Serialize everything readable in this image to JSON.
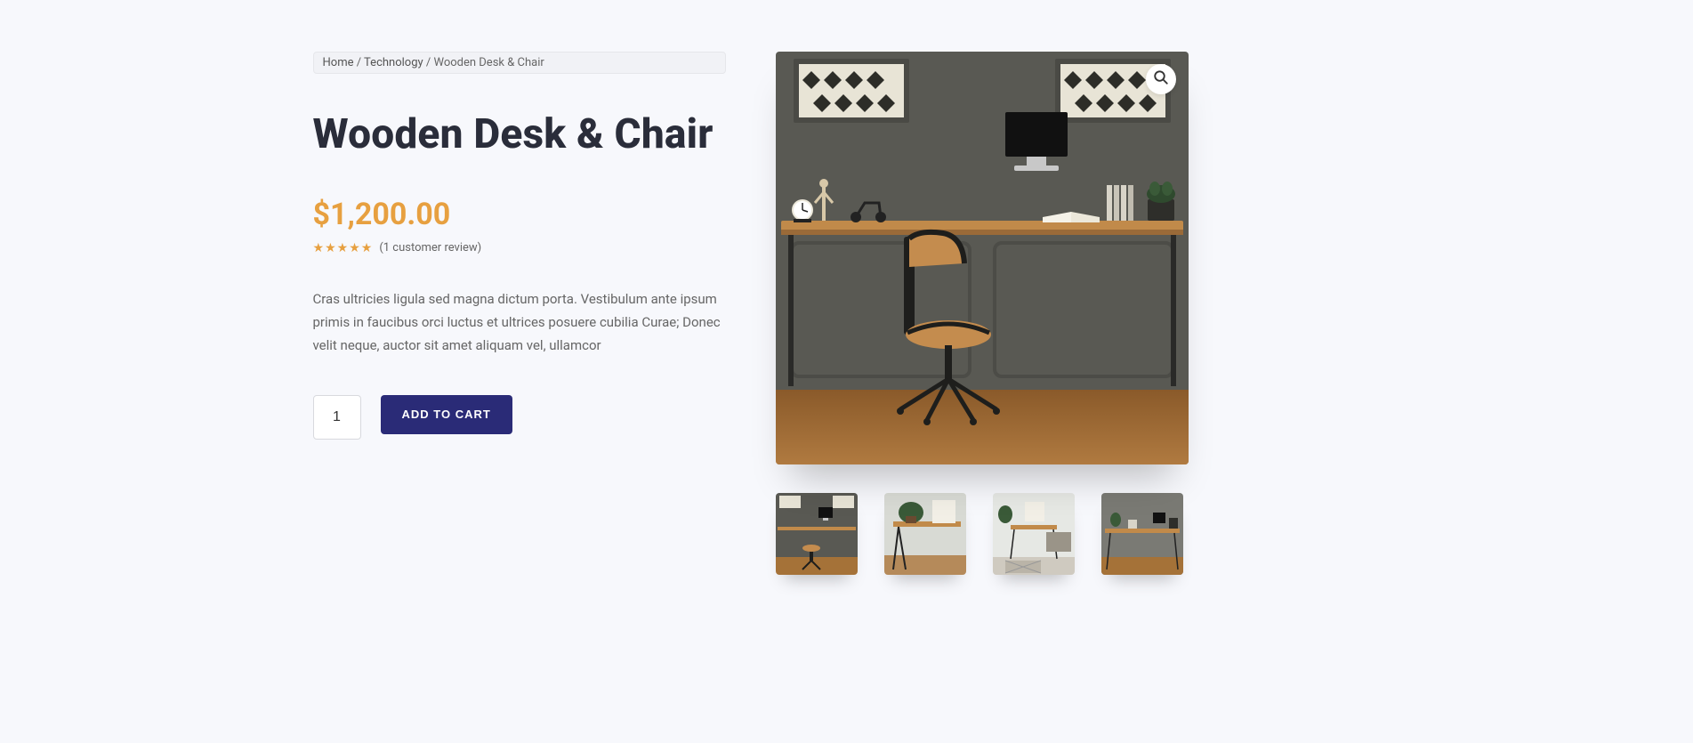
{
  "breadcrumb": {
    "home": "Home",
    "category": "Technology",
    "current": "Wooden Desk & Chair",
    "sep": " / "
  },
  "product": {
    "title": "Wooden Desk & Chair",
    "currency": "$",
    "price": "1,200.00",
    "rating_stars": 5,
    "review_link": "(1 customer review)",
    "description": "Cras ultricies ligula sed magna dictum porta. Vestibulum ante ipsum primis in faucibus orci luctus et ultrices posuere cubilia Curae; Donec velit neque, auctor sit amet aliquam vel, ullamcor",
    "qty": "1",
    "add_to_cart": "ADD TO CART"
  },
  "gallery": {
    "zoom_icon": "search-icon",
    "thumb_count": 4
  },
  "colors": {
    "accent": "#e7a040",
    "primary_btn": "#2a2b77"
  }
}
